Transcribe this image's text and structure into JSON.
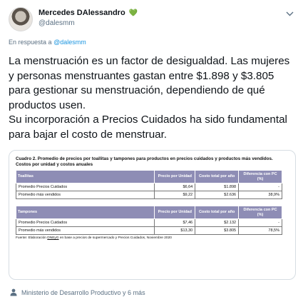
{
  "header": {
    "display_name": "Mercedes DAlessandro",
    "heart": "💚",
    "handle": "@dalesmm"
  },
  "reply": {
    "prefix": "En respuesta a",
    "mention": "@dalesmm"
  },
  "tweet": {
    "paragraph1": "La menstruación es un factor de desigualdad. Las mujeres y personas menstruantes gastan entre $1.898 y $3.805 para gestionar su menstruación, dependiendo de qué productos usen.",
    "paragraph2": "Su incorporación a Precios Cuidados ha sido fundamental para bajar el costo de menstruar."
  },
  "card": {
    "title": "Cuadro 2. Promedio de precios por toallitas y tampones para productos en precios cuidados y productos más vendidos. Costos por unidad y costos anuales",
    "tables": [
      {
        "headers": [
          "Toallitas",
          "Precio por Unidad",
          "Costo total por año",
          "Diferencia con PC (%)"
        ],
        "rows": [
          [
            "Promedio Precios Cuidados",
            "$6,64",
            "$1.898",
            "-"
          ],
          [
            "Promedio más vendidos",
            "$9,22",
            "$2.636",
            "38,9%"
          ]
        ]
      },
      {
        "headers": [
          "Tampones",
          "Precio por Unidad",
          "Costo total por año",
          "Diferencia con PC (%)"
        ],
        "rows": [
          [
            "Promedio Precios Cuidados",
            "$7,46",
            "$2.132",
            "-"
          ],
          [
            "Promedio más vendidos",
            "$13,30",
            "$3.805",
            "78,5%"
          ]
        ]
      }
    ],
    "source_prefix": "Fuente: Elaboración ",
    "source_org": "DNEyG",
    "source_suffix": " en base a precios de supermercado y Precios Cuidados, Noviembre 2020"
  },
  "footer": {
    "text": "Ministerio de Desarrollo Productivo y 6 más"
  }
}
